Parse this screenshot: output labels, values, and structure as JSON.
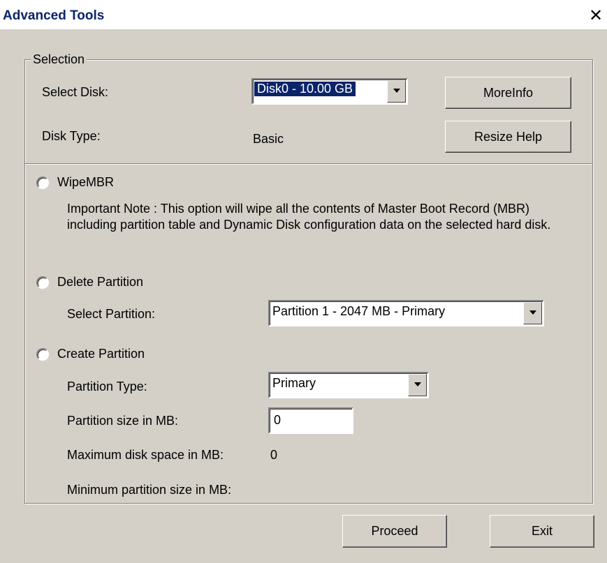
{
  "window": {
    "title": "Advanced Tools",
    "close_glyph": "✕"
  },
  "selection": {
    "legend": "Selection",
    "select_disk_label": "Select Disk:",
    "disk_value": "Disk0 - 10.00 GB",
    "disk_type_label": "Disk Type:",
    "disk_type_value": "Basic",
    "more_info_button": "MoreInfo",
    "resize_help_button": "Resize Help"
  },
  "wipe": {
    "label": "WipeMBR",
    "note": "Important Note : This option will wipe all the contents of Master Boot Record (MBR) including partition table and Dynamic Disk configuration data on the selected hard disk."
  },
  "delete": {
    "label": "Delete Partition",
    "select_partition_label": "Select Partition:",
    "partition_value": "Partition 1 - 2047 MB - Primary"
  },
  "create": {
    "label": "Create Partition",
    "partition_type_label": "Partition Type:",
    "partition_type_value": "Primary",
    "size_label": "Partition size in MB:",
    "size_value": "0",
    "max_label": "Maximum disk space in MB:",
    "max_value": "0",
    "min_label": "Minimum partition size in MB:"
  },
  "footer": {
    "proceed_button": "Proceed",
    "exit_button": "Exit"
  },
  "colors": {
    "dialog_bg": "#d4d0c8",
    "title_text": "#0a246a",
    "selection_highlight": "#0a246a"
  }
}
